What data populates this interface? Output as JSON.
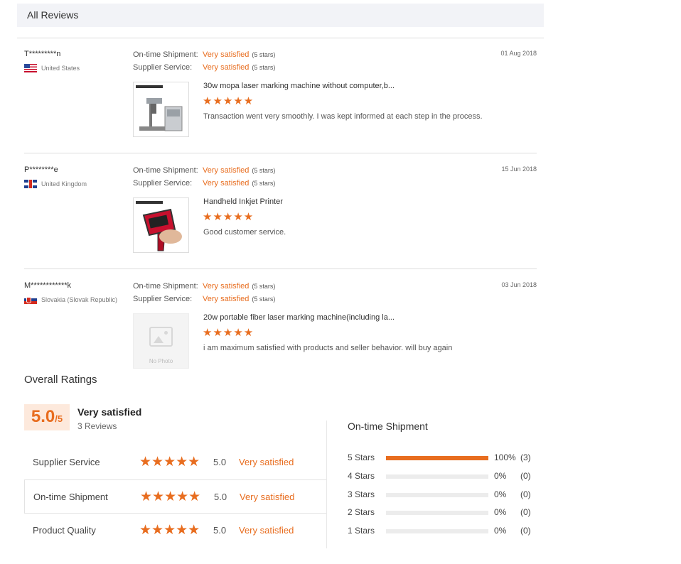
{
  "header": {
    "title": "All Reviews"
  },
  "reviews": [
    {
      "reviewer": "T*********n",
      "country": "United States",
      "flag": "us",
      "shipment_label": "On-time Shipment:",
      "shipment_value": "Very satisfied",
      "shipment_stars": "(5 stars)",
      "service_label": "Supplier Service:",
      "service_value": "Very satisfied",
      "service_stars": "(5 stars)",
      "date": "01 Aug 2018",
      "product_title": "30w mopa laser marking machine without computer,b...",
      "rating": "★★★★★",
      "text": "Transaction went very smoothly. I was kept informed at each step in the process."
    },
    {
      "reviewer": "P********e",
      "country": "United Kingdom",
      "flag": "uk",
      "shipment_label": "On-time Shipment:",
      "shipment_value": "Very satisfied",
      "shipment_stars": "(5 stars)",
      "service_label": "Supplier Service:",
      "service_value": "Very satisfied",
      "service_stars": "(5 stars)",
      "date": "15 Jun 2018",
      "product_title": "Handheld Inkjet Printer",
      "rating": "★★★★★",
      "text": "Good customer service."
    },
    {
      "reviewer": "M************k",
      "country": "Slovakia (Slovak Republic)",
      "flag": "sk",
      "shipment_label": "On-time Shipment:",
      "shipment_value": "Very satisfied",
      "shipment_stars": "(5 stars)",
      "service_label": "Supplier Service:",
      "service_value": "Very satisfied",
      "service_stars": "(5 stars)",
      "date": "03 Jun 2018",
      "product_title": "20w portable fiber laser marking machine(including la...",
      "rating": "★★★★★",
      "text": "i am maximum satisfied with products and seller behavior. will buy again",
      "no_photo_label": "No Photo"
    }
  ],
  "overall": {
    "title": "Overall Ratings",
    "score": "5.0",
    "score_max": "/5",
    "label": "Very satisfied",
    "count": "3 Reviews",
    "rows": [
      {
        "name": "Supplier Service",
        "stars": "★★★★★",
        "value": "5.0",
        "text": "Very satisfied"
      },
      {
        "name": "On-time Shipment",
        "stars": "★★★★★",
        "value": "5.0",
        "text": "Very satisfied"
      },
      {
        "name": "Product Quality",
        "stars": "★★★★★",
        "value": "5.0",
        "text": "Very satisfied"
      }
    ]
  },
  "shipment_dist": {
    "title": "On-time Shipment",
    "rows": [
      {
        "label": "5  Stars",
        "fraction": 1.0,
        "pct": "100%",
        "count": "(3)"
      },
      {
        "label": "4  Stars",
        "fraction": 0,
        "pct": "0%",
        "count": "(0)"
      },
      {
        "label": "3  Stars",
        "fraction": 0,
        "pct": "0%",
        "count": "(0)"
      },
      {
        "label": "2  Stars",
        "fraction": 0,
        "pct": "0%",
        "count": "(0)"
      },
      {
        "label": "1  Stars",
        "fraction": 0,
        "pct": "0%",
        "count": "(0)"
      }
    ]
  },
  "colors": {
    "accent": "#e86d1f",
    "score_bg": "#fde9dc",
    "header_bg": "#f2f3f7"
  }
}
